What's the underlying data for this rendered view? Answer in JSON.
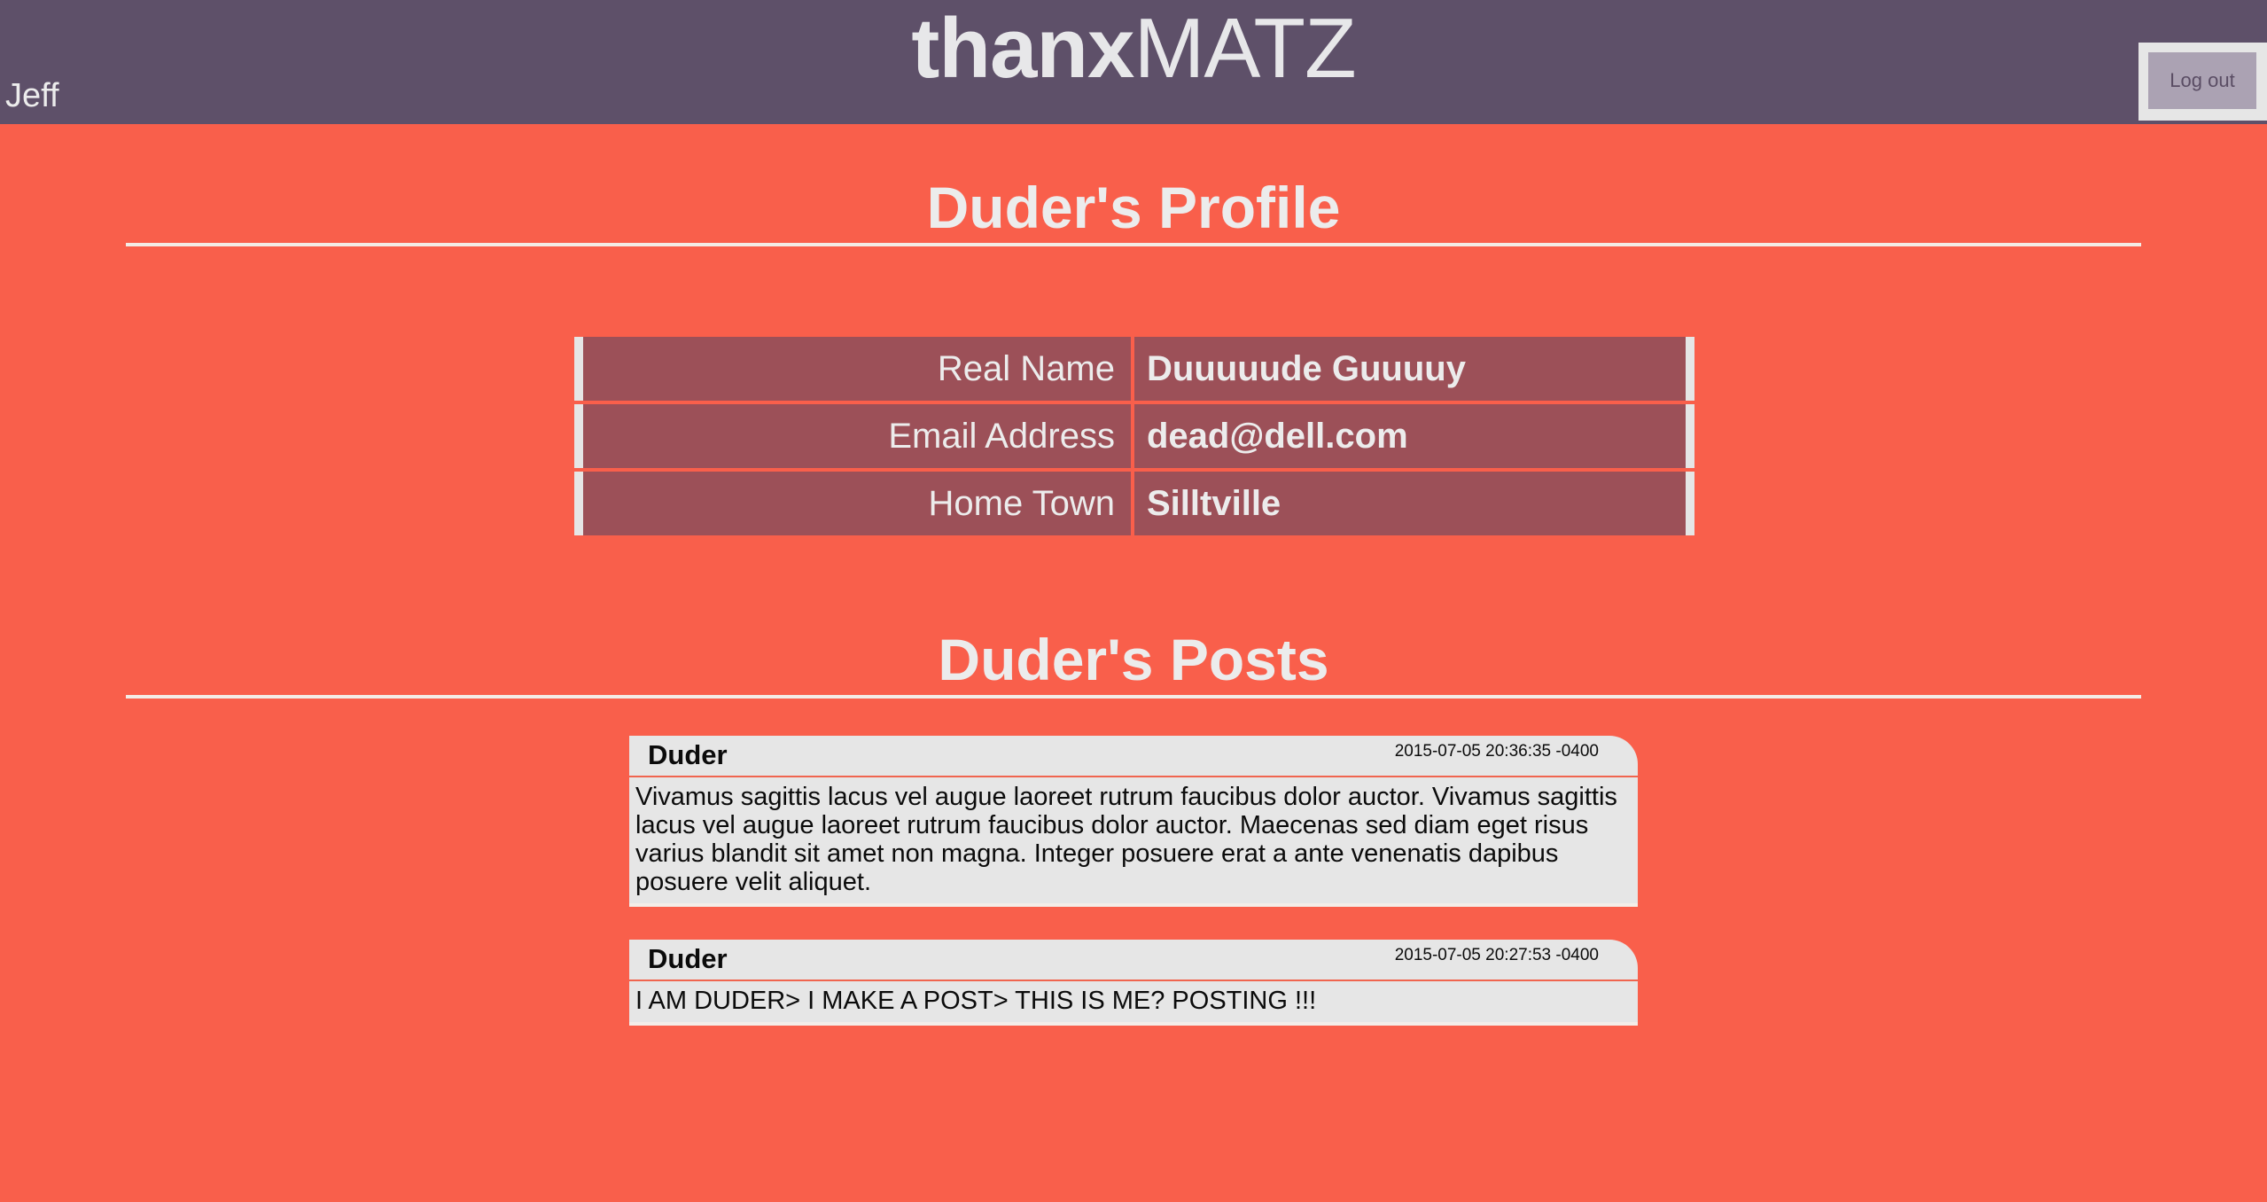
{
  "header": {
    "brand_bold": "thanx",
    "brand_light": "MATZ",
    "current_user": "Jeff",
    "logout_label": "Log out"
  },
  "profile": {
    "title": "Duder's Profile",
    "fields": [
      {
        "label": "Real Name",
        "value": "Duuuuude Guuuuy"
      },
      {
        "label": "Email Address",
        "value": "dead@dell.com"
      },
      {
        "label": "Home Town",
        "value": "Silltville"
      }
    ]
  },
  "posts": {
    "title": "Duder's Posts",
    "items": [
      {
        "author": "Duder",
        "timestamp": "2015-07-05 20:36:35 -0400",
        "body": "Vivamus sagittis lacus vel augue laoreet rutrum faucibus dolor auctor. Vivamus sagittis lacus vel augue laoreet rutrum faucibus dolor auctor. Maecenas sed diam eget risus varius blandit sit amet non magna. Integer posuere erat a ante venenatis dapibus posuere velit aliquet."
      },
      {
        "author": "Duder",
        "timestamp": "2015-07-05 20:27:53 -0400",
        "body": "I AM DUDER> I MAKE A POST> THIS IS ME? POSTING !!!"
      }
    ]
  },
  "colors": {
    "background": "#f95f4b",
    "header": "#5e5069",
    "table_cell": "#9c5058",
    "post_card": "#e6e6e6"
  }
}
